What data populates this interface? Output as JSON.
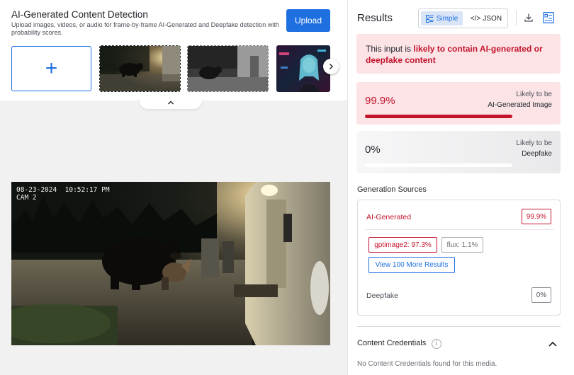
{
  "upload": {
    "title": "AI-Generated Content Detection",
    "subtitle": "Upload images, videos, or audio for frame-by-frame AI-Generated and Deepfake detection with probability scores.",
    "upload_button": "Upload",
    "add_symbol": "+"
  },
  "preview": {
    "timestamp": "08-23-2024  10:52:17 PM",
    "camera": "CAM 2"
  },
  "results": {
    "title": "Results",
    "view_toggle": {
      "simple": "Simple",
      "json": "JSON",
      "selected": "Simple"
    },
    "verdict": {
      "prefix": "This input is ",
      "highlight": "likely to contain AI-generated or deepfake content"
    },
    "scores": [
      {
        "percent": "99.9%",
        "value": 0.999,
        "caption": "Likely to be",
        "label": "AI-Generated Image"
      },
      {
        "percent": "0%",
        "value": 0.0,
        "caption": "Likely to be",
        "label": "Deepfake"
      }
    ],
    "generation_sources": {
      "title": "Generation Sources",
      "ai_label": "AI-Generated",
      "ai_value": "99.9%",
      "models": [
        {
          "text": "gptimage2: 97.3%"
        },
        {
          "text": "flux: 1.1%"
        }
      ],
      "more_button": "View 100 More Results",
      "deepfake_label": "Deepfake",
      "deepfake_value": "0%"
    },
    "content_credentials": {
      "title": "Content Credentials",
      "message": "No Content Credentials found for this media."
    }
  },
  "colors": {
    "accent": "#1e6fe0",
    "danger": "#c4142c",
    "danger_bg": "#fbe3e6"
  }
}
